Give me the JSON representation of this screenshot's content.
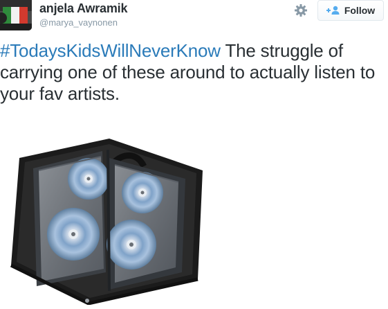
{
  "author": {
    "name": "anjela Awramik",
    "handle": "@marya_vaynonen"
  },
  "header": {
    "follow_label": "Follow",
    "settings_icon": "gear-icon",
    "follow_icon": "add-user-icon"
  },
  "tweet": {
    "hashtag": "#TodaysKidsWillNeverKnow",
    "body": " The struggle of carrying one of these around to actually listen to your fav artists."
  },
  "media": {
    "subject": "cd-wallet-image"
  },
  "colors": {
    "link": "#2b7bb9",
    "text": "#292f33",
    "muted": "#8899a6",
    "button_border": "#e1e8ed"
  }
}
